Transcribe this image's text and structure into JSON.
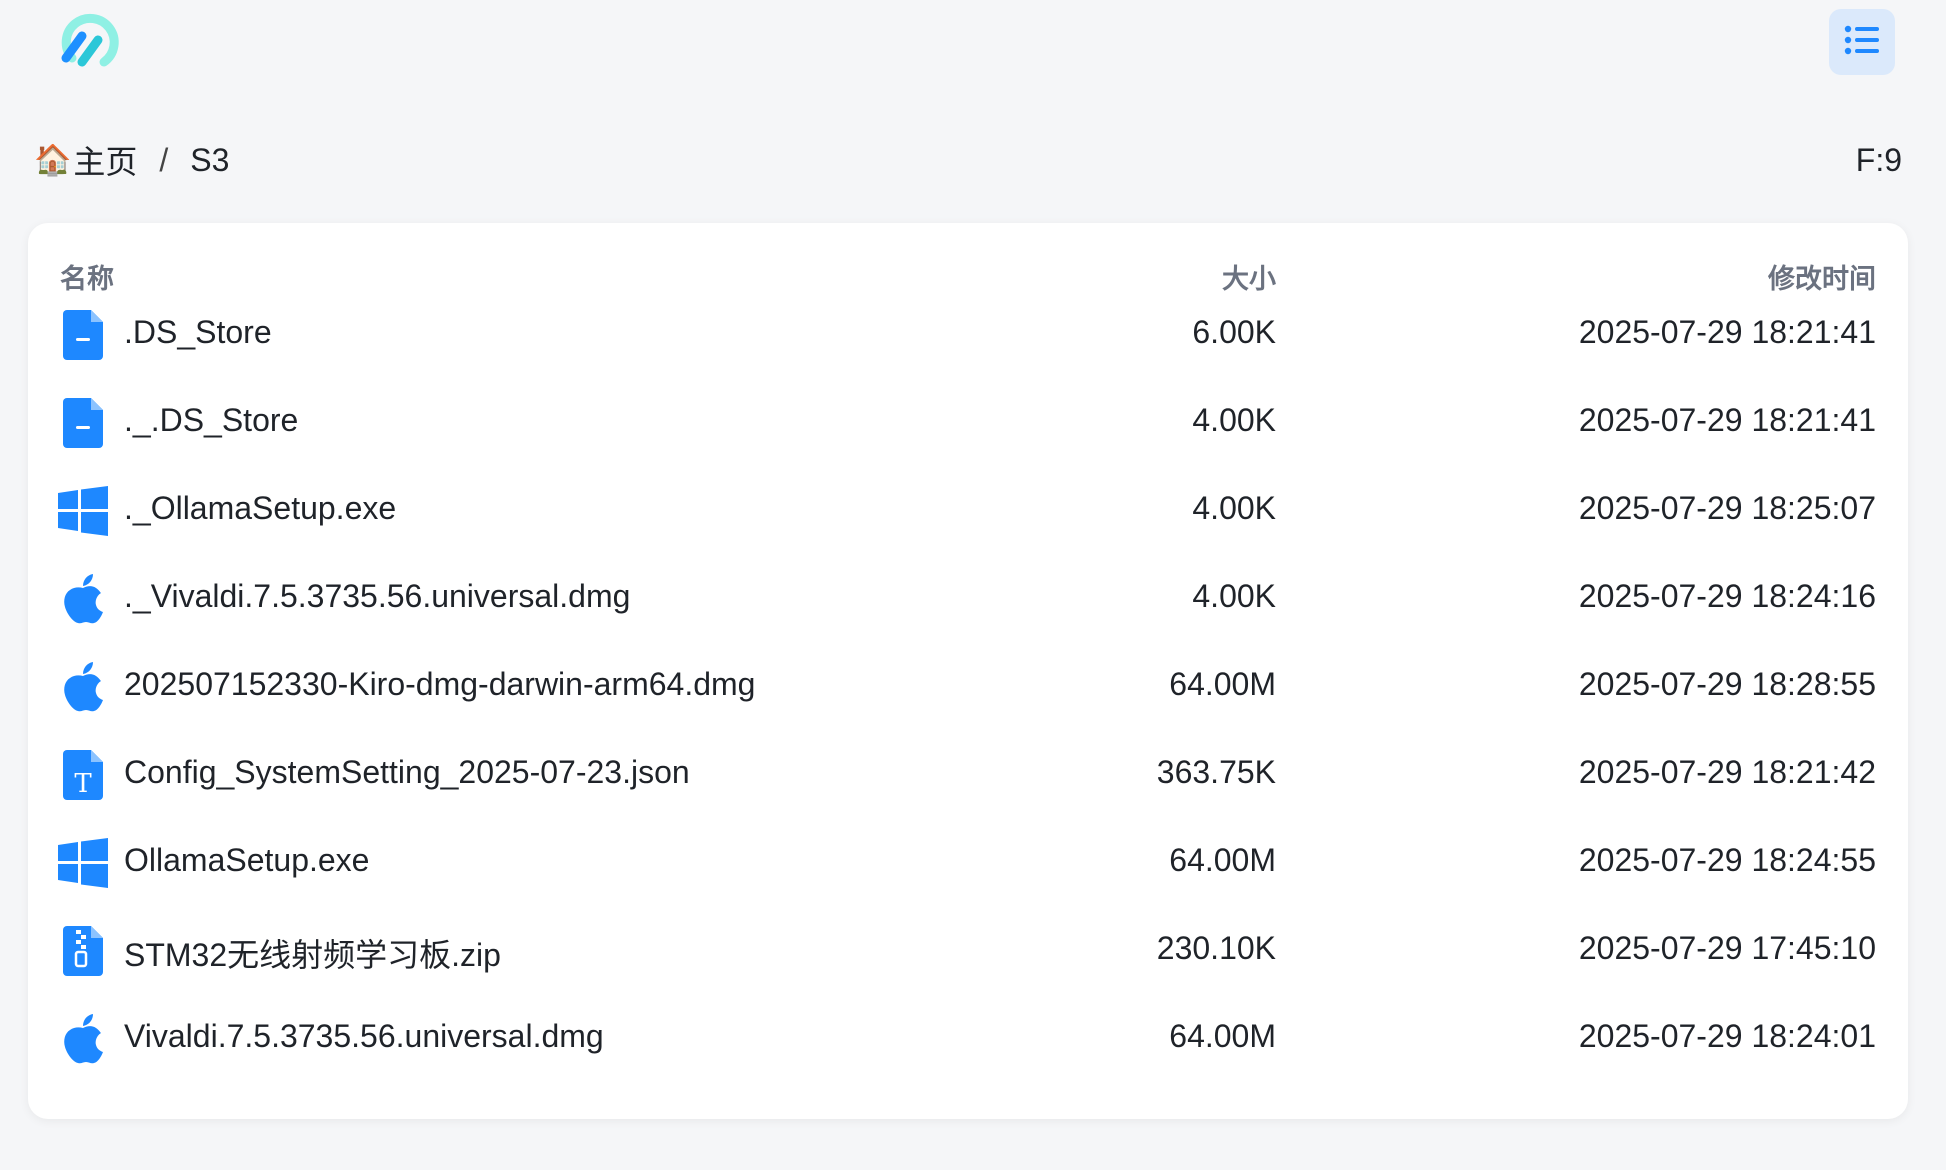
{
  "header": {
    "logo_icon": "brand-logo-icon",
    "menu_icon": "list-view-icon",
    "accent": "#1e88ff",
    "logo_color": "#5fe0d2"
  },
  "breadcrumb": {
    "home_icon": "🏠",
    "home_label": "主页",
    "separator": "/",
    "current": "S3"
  },
  "file_count": "F:9",
  "table": {
    "columns": {
      "name": "名称",
      "size": "大小",
      "modified": "修改时间"
    },
    "rows": [
      {
        "icon": "file-icon",
        "name": ".DS_Store",
        "size": "6.00K",
        "modified": "2025-07-29 18:21:41"
      },
      {
        "icon": "file-icon",
        "name": "._.DS_Store",
        "size": "4.00K",
        "modified": "2025-07-29 18:21:41"
      },
      {
        "icon": "windows-icon",
        "name": "._OllamaSetup.exe",
        "size": "4.00K",
        "modified": "2025-07-29 18:25:07"
      },
      {
        "icon": "apple-icon",
        "name": "._Vivaldi.7.5.3735.56.universal.dmg",
        "size": "4.00K",
        "modified": "2025-07-29 18:24:16"
      },
      {
        "icon": "apple-icon",
        "name": "202507152330-Kiro-dmg-darwin-arm64.dmg",
        "size": "64.00M",
        "modified": "2025-07-29 18:28:55"
      },
      {
        "icon": "text-file-icon",
        "name": "Config_SystemSetting_2025-07-23.json",
        "size": "363.75K",
        "modified": "2025-07-29 18:21:42"
      },
      {
        "icon": "windows-icon",
        "name": "OllamaSetup.exe",
        "size": "64.00M",
        "modified": "2025-07-29 18:24:55"
      },
      {
        "icon": "zip-file-icon",
        "name": "STM32无线射频学习板.zip",
        "size": "230.10K",
        "modified": "2025-07-29 17:45:10"
      },
      {
        "icon": "apple-icon",
        "name": "Vivaldi.7.5.3735.56.universal.dmg",
        "size": "64.00M",
        "modified": "2025-07-29 18:24:01"
      }
    ]
  }
}
